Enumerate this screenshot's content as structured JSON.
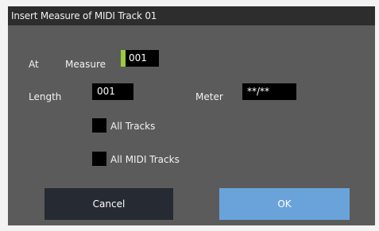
{
  "dialog": {
    "title": "Insert Measure of MIDI Track 01",
    "at_label": "At",
    "measure_label": "Measure",
    "measure_value": "001",
    "length_label": "Length",
    "length_value": "001",
    "meter_label": "Meter",
    "meter_value": "**/**",
    "all_tracks_label": "All Tracks",
    "all_tracks_checked": false,
    "all_midi_tracks_label": "All MIDI Tracks",
    "all_midi_tracks_checked": false,
    "cancel_label": "Cancel",
    "ok_label": "OK"
  },
  "colors": {
    "dialog_background": "#5b5b5b",
    "title_bar": "#2d2d2d",
    "focus_accent": "#9acb3d",
    "ok_button": "#6aa3da",
    "cancel_button": "#262a33"
  }
}
